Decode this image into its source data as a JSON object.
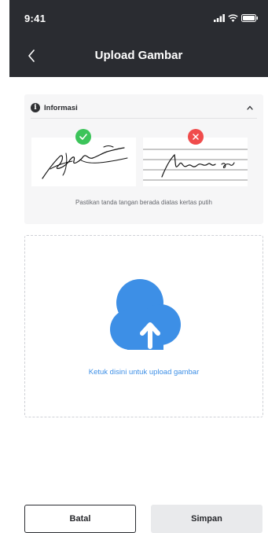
{
  "status_bar": {
    "time": "9:41"
  },
  "header": {
    "title": "Upload Gambar"
  },
  "info": {
    "title": "Informasi",
    "caption": "Pastikan tanda tangan berada diatas kertas putih"
  },
  "upload": {
    "label": "Ketuk disini untuk upload gambar"
  },
  "actions": {
    "cancel_label": "Batal",
    "save_label": "Simpan"
  },
  "colors": {
    "header_bg": "#2a2c31",
    "accent": "#3d8fe6",
    "ok": "#3cc45a",
    "error": "#f04c4c"
  }
}
